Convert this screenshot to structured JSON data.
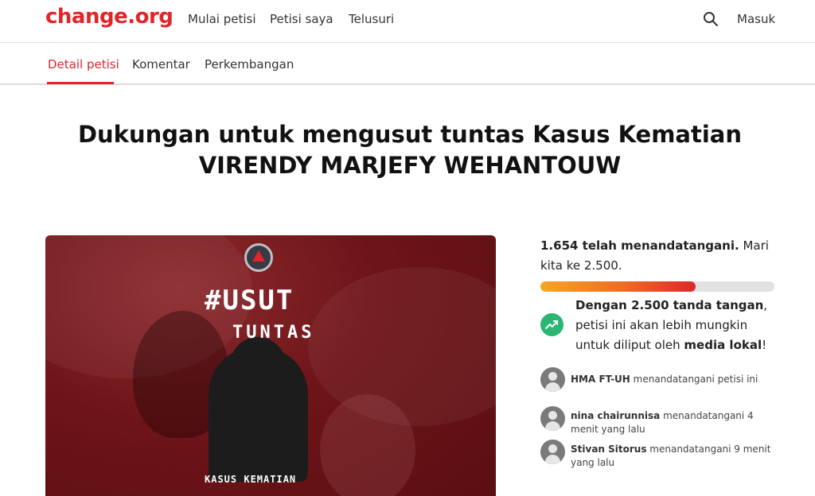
{
  "nav": {
    "logo": "change.org",
    "links": [
      "Mulai petisi",
      "Petisi saya",
      "Telusuri"
    ],
    "login": "Masuk"
  },
  "tabs": [
    "Detail petisi",
    "Komentar",
    "Perkembangan"
  ],
  "petition": {
    "title_line1": "Dukungan untuk mengusut tuntas Kasus Kematian",
    "title_line2": "VIRENDY MARJEFY WEHANTOUW"
  },
  "hero": {
    "hashtag_line1": "#USUT",
    "hashtag_line2": "TUNTAS",
    "banner": "KASUS KEMATIAN"
  },
  "signatures": {
    "count": "1.654 telah menandatangani.",
    "goal_text": " Mari kita ke 2.500.",
    "progress_fraction": 0.6616,
    "goal_highlight": "Dengan 2.500 tanda tangan",
    "goal_mid": ", petisi ini akan lebih mungkin untuk diliput oleh ",
    "goal_media": "media lokal",
    "goal_end": "!"
  },
  "recent_signers": [
    {
      "name": "HMA FT-UH",
      "action": " menandatangani petisi ini"
    },
    {
      "name": "nina chairunnisa",
      "action": " menandatangani 4 menit yang lalu"
    },
    {
      "name": "Stivan Sitorus",
      "action": " menandatangani 9 menit yang lalu"
    }
  ],
  "colors": {
    "brand": "#e0262a",
    "trend_badge": "#2bb673",
    "progress_start": "#f5a623",
    "progress_end": "#e0262a"
  },
  "icons": {
    "search": "search-icon",
    "trend": "trending-up-icon",
    "avatar": "default-avatar-icon"
  }
}
